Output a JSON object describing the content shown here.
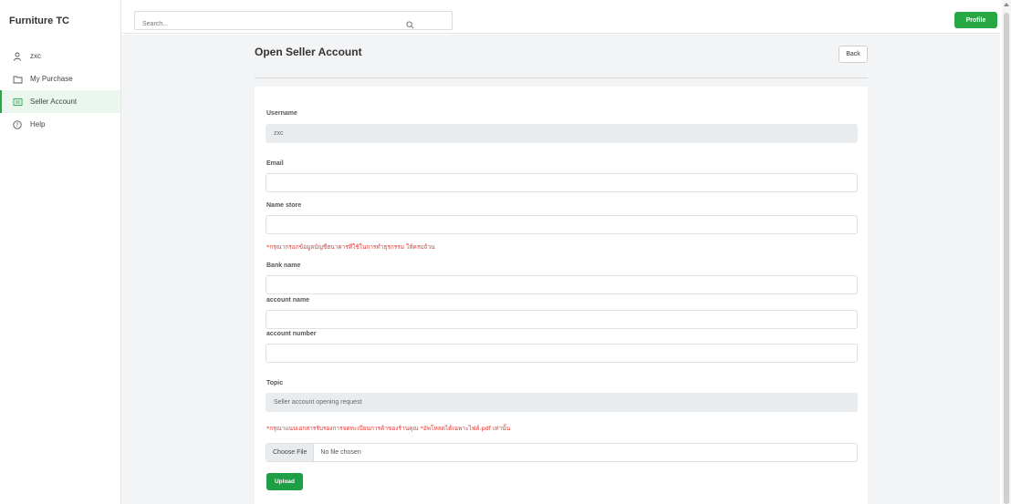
{
  "sidebar": {
    "brand": "Furniture TC",
    "items": [
      {
        "label": "zxc",
        "icon": "user-icon"
      },
      {
        "label": "My Purchase",
        "icon": "folder-icon"
      },
      {
        "label": "Seller Account",
        "icon": "card-icon",
        "active": true
      },
      {
        "label": "Help",
        "icon": "help-icon"
      }
    ]
  },
  "topbar": {
    "search_placeholder": "Search...",
    "profile_label": "Profile"
  },
  "page": {
    "title": "Open Seller Account",
    "back_label": "Back"
  },
  "form": {
    "username_label": "Username",
    "username_value": "zxc",
    "email_label": "Email",
    "email_value": "",
    "store_label": "Name store",
    "store_value": "",
    "bank_note": "*กรุณากรอกข้อมูลบัญชีธนาคารที่ใช้ในการทำธุรกรรม ให้ครบถ้วน",
    "bank_label": "Bank name",
    "bank_value": "",
    "account_name_label": "account name",
    "account_name_value": "",
    "account_number_label": "account number",
    "account_number_value": "",
    "topic_label": "Topic",
    "topic_value": "Seller account opening request",
    "file_note": "*กรุณาแนบเอกสารรับรองการจดทะเบียนการค้าของร้านคุณ *อัพโหลดได้เฉพาะไฟล์.pdf เท่านั้น",
    "choose_file_label": "Choose File",
    "no_file_label": "No file chosen",
    "upload_label": "Upload"
  },
  "colors": {
    "accent": "#28a745",
    "note": "#e53935",
    "background": "#f3f4f6"
  }
}
